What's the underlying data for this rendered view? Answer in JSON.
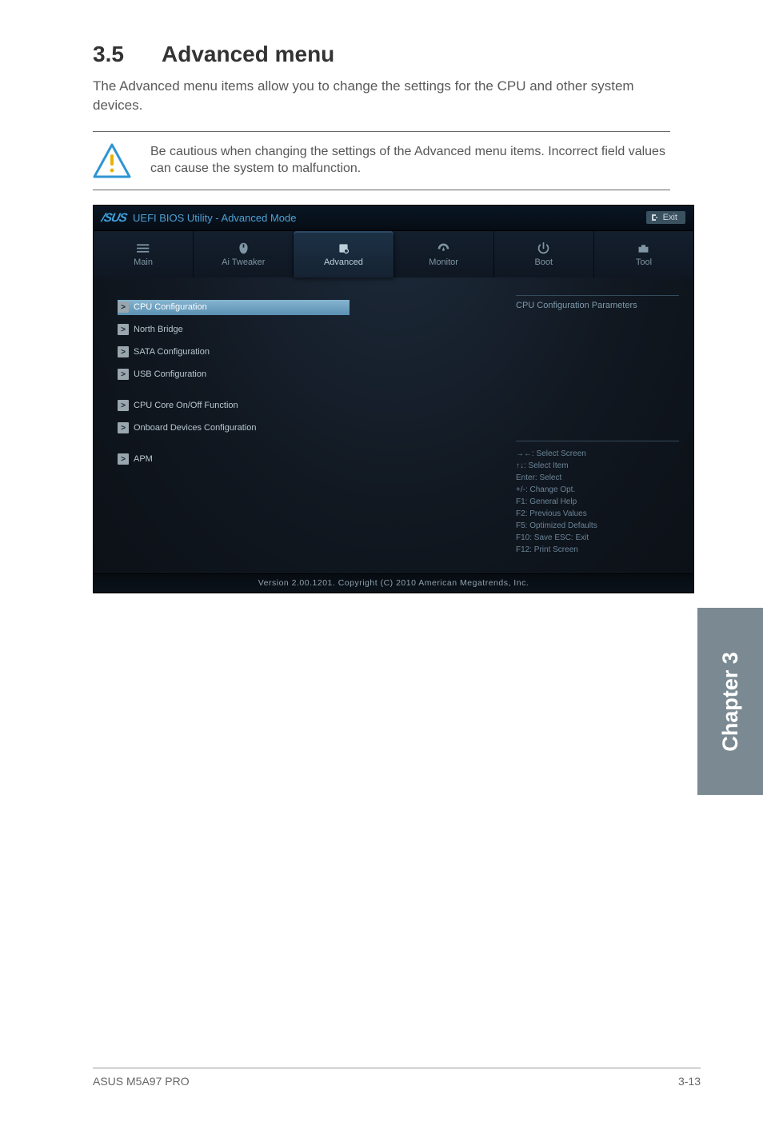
{
  "heading": {
    "num": "3.5",
    "title": "Advanced menu"
  },
  "intro": "The Advanced menu items allow you to change the settings for the CPU and other system devices.",
  "caution": "Be cautious when changing the settings of the Advanced menu items. Incorrect field values can cause the system to malfunction.",
  "bios": {
    "brand": "/SUS",
    "title": "UEFI BIOS Utility - Advanced Mode",
    "exit": "Exit",
    "tabs": [
      {
        "name": "main",
        "label": "Main"
      },
      {
        "name": "tweaker",
        "label": "Ai  Tweaker"
      },
      {
        "name": "advanced",
        "label": "Advanced"
      },
      {
        "name": "monitor",
        "label": "Monitor"
      },
      {
        "name": "boot",
        "label": "Boot"
      },
      {
        "name": "tool",
        "label": "Tool"
      }
    ],
    "menu": [
      {
        "label": "CPU Configuration",
        "selected": true,
        "gap": false
      },
      {
        "label": "North Bridge",
        "selected": false,
        "gap": false
      },
      {
        "label": "SATA Configuration",
        "selected": false,
        "gap": false
      },
      {
        "label": "USB Configuration",
        "selected": false,
        "gap": true
      },
      {
        "label": "CPU Core On/Off Function",
        "selected": false,
        "gap": false
      },
      {
        "label": "Onboard Devices Configuration",
        "selected": false,
        "gap": true
      },
      {
        "label": "APM",
        "selected": false,
        "gap": false
      }
    ],
    "help_title": "CPU Configuration Parameters",
    "hints": [
      "→←:  Select Screen",
      "↑↓:  Select Item",
      "Enter:  Select",
      "+/-:  Change Opt.",
      "F1:  General Help",
      "F2:  Previous Values",
      "F5:  Optimized Defaults",
      "F10:  Save    ESC:  Exit",
      "F12: Print Screen"
    ],
    "footer": "Version  2.00.1201.    Copyright  (C)  2010  American  Megatrends,  Inc."
  },
  "chapter_tab": "Chapter 3",
  "page_footer": {
    "left": "ASUS M5A97 PRO",
    "right": "3-13"
  }
}
